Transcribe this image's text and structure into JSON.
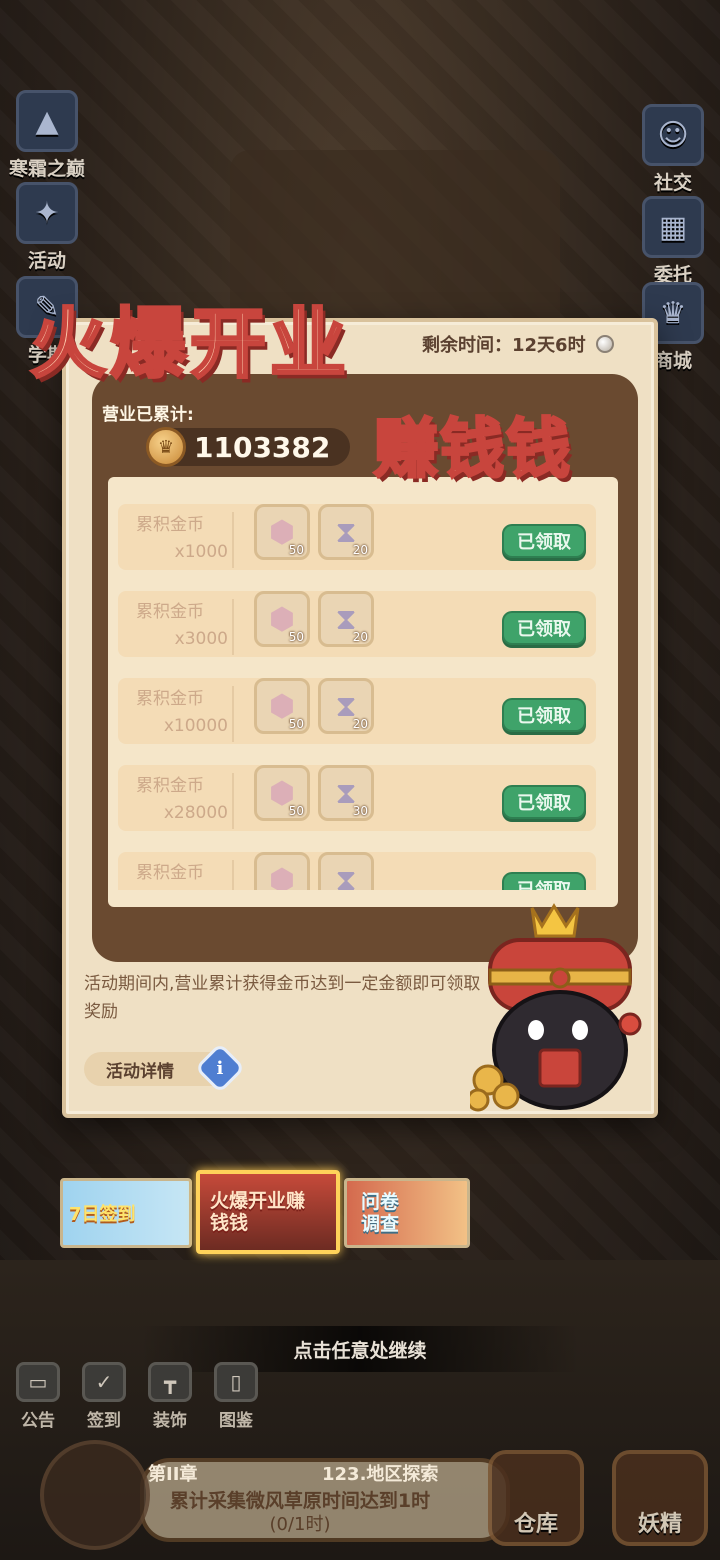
{
  "side_left": [
    {
      "label": "寒霜之巅",
      "icon": "mountain-icon"
    },
    {
      "label": "活动",
      "icon": "event-icon"
    },
    {
      "label": "学期",
      "icon": "semester-icon"
    }
  ],
  "side_right": [
    {
      "label": "社交",
      "icon": "social-icon"
    },
    {
      "label": "委托",
      "icon": "commission-icon"
    },
    {
      "label": "商城",
      "icon": "shop-icon"
    }
  ],
  "event": {
    "title_main": "火爆开业",
    "title_sub": "赚钱钱",
    "timer_label": "剩余时间：12天6时",
    "accum_label": "营业已累计:",
    "accum_value": "1103382",
    "rewards": [
      {
        "name": "累积金币",
        "amount": "x1000",
        "items": [
          {
            "icon": "gem-icon",
            "count": "50"
          },
          {
            "icon": "hourglass-icon",
            "count": "20"
          }
        ],
        "status": "已领取"
      },
      {
        "name": "累积金币",
        "amount": "x3000",
        "items": [
          {
            "icon": "gem-icon",
            "count": "50"
          },
          {
            "icon": "hourglass-icon",
            "count": "20"
          }
        ],
        "status": "已领取"
      },
      {
        "name": "累积金币",
        "amount": "x10000",
        "items": [
          {
            "icon": "gem-icon",
            "count": "50"
          },
          {
            "icon": "hourglass-icon",
            "count": "20"
          }
        ],
        "status": "已领取"
      },
      {
        "name": "累积金币",
        "amount": "x28000",
        "items": [
          {
            "icon": "gem-icon",
            "count": "50"
          },
          {
            "icon": "hourglass-icon",
            "count": "30"
          }
        ],
        "status": "已领取"
      },
      {
        "name": "累积金币",
        "amount": "",
        "items": [
          {
            "icon": "gem-icon",
            "count": ""
          },
          {
            "icon": "hourglass-icon",
            "count": ""
          }
        ],
        "status": "已领取"
      }
    ],
    "description": "活动期间内,营业累计获得金币达到一定金额即可领取奖励",
    "detail_label": "活动详情"
  },
  "tabs": [
    {
      "label": "7日签到"
    },
    {
      "label": "火爆开业赚钱钱"
    },
    {
      "label": "问卷调查"
    }
  ],
  "continue_hint": "点击任意处继续",
  "bottom_bar": [
    {
      "label": "公告",
      "icon": "notice-icon"
    },
    {
      "label": "签到",
      "icon": "calendar-icon"
    },
    {
      "label": "装饰",
      "icon": "decoration-icon"
    },
    {
      "label": "图鉴",
      "icon": "catalog-icon"
    }
  ],
  "quest": {
    "chapter": "第II章",
    "area": "123.地区探索",
    "goal": "累计采集微风草原时间达到1时",
    "progress": "(0/1时)"
  },
  "big_buttons": [
    {
      "label": "仓库",
      "icon": "warehouse-icon"
    },
    {
      "label": "妖精",
      "icon": "fairy-icon"
    }
  ],
  "colors": {
    "claimed_green": "#3fa36a",
    "title_red": "#c8453d",
    "panel_bg": "#efe0c4"
  }
}
